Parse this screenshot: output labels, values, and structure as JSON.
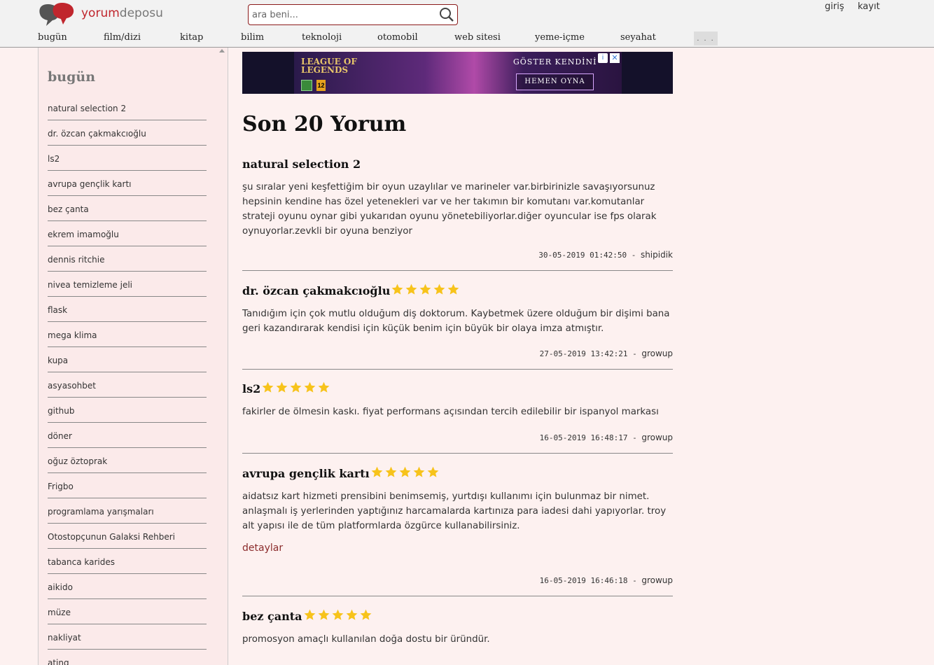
{
  "header": {
    "logo": {
      "part1": "yorum",
      "part2": "deposu"
    },
    "search_placeholder": "ara beni...",
    "login": "giriş",
    "register": "kayıt",
    "nav": [
      "bugün",
      "film/dizi",
      "kitap",
      "bilim",
      "teknoloji",
      "otomobil",
      "web sitesi",
      "yeme-içme",
      "seyahat"
    ],
    "nav_more": ". . ."
  },
  "sidebar": {
    "title": "bugün",
    "items": [
      "natural selection 2",
      "dr. özcan çakmakcıoğlu",
      "ls2",
      "avrupa gençlik kartı",
      "bez çanta",
      "ekrem imamoğlu",
      "dennis ritchie",
      "nivea temizleme jeli",
      "flask",
      "mega klima",
      "kupa",
      "asyasohbet",
      "github",
      "döner",
      "oğuz öztoprak",
      "Frigbo",
      "programlama yarışmaları",
      "Otostopçunun Galaksi Rehberi",
      "tabanca karides",
      "aikido",
      "müze",
      "nakliyat",
      "ating"
    ]
  },
  "ad": {
    "brand": "LEAGUE OF LEGENDS",
    "tagline": "GÖSTER  KENDİNİ",
    "cta": "HEMEN OYNA",
    "age": "12",
    "info": "i",
    "close": "✕"
  },
  "main": {
    "title": "Son 20 Yorum",
    "reviews": [
      {
        "title": "natural selection 2",
        "stars": 0,
        "text": "şu sıralar yeni keşfettiğim bir oyun uzaylılar ve marineler var.birbirinizle savaşıyorsunuz hepsinin kendine has özel yetenekleri var ve her takımın bir komutanı var.komutanlar strateji oyunu oynar gibi yukarıdan oyunu yönetebiliyorlar.diğer oyuncular ise fps olarak oynuyorlar.zevkli bir oyuna benziyor",
        "date": "30-05-2019 01:42:50",
        "user": "shipidik"
      },
      {
        "title": "dr. özcan çakmakcıoğlu",
        "stars": 5,
        "text": "Tanıdığım için çok mutlu olduğum diş doktorum. Kaybetmek üzere olduğum bir dişimi bana geri kazandırarak kendisi için küçük benim için büyük bir olaya imza atmıştır.",
        "date": "27-05-2019 13:42:21",
        "user": "growup"
      },
      {
        "title": "ls2",
        "stars": 5,
        "text": "fakirler de ölmesin kaskı. fiyat performans açısından tercih edilebilir bir ispanyol markası",
        "date": "16-05-2019 16:48:17",
        "user": "growup"
      },
      {
        "title": "avrupa gençlik kartı",
        "stars": 5,
        "text": "aidatsız kart hizmeti prensibini benimsemiş, yurtdışı kullanımı için bulunmaz bir nimet. anlaşmalı iş yerlerinden yaptığınız harcamalarda kartınıza para iadesi dahi yapıyorlar. troy alt yapısı ile de tüm platformlarda özgürce kullanabilirsiniz.",
        "link": "detaylar",
        "date": "16-05-2019 16:46:18",
        "user": "growup"
      },
      {
        "title": "bez çanta",
        "stars": 5,
        "text": "promosyon amaçlı kullanılan doğa dostu bir üründür."
      }
    ],
    "meta_separator": "-"
  },
  "colors": {
    "accent": "#8b1a1a",
    "star": "#f7c31b",
    "background": "#fdf1f0"
  }
}
